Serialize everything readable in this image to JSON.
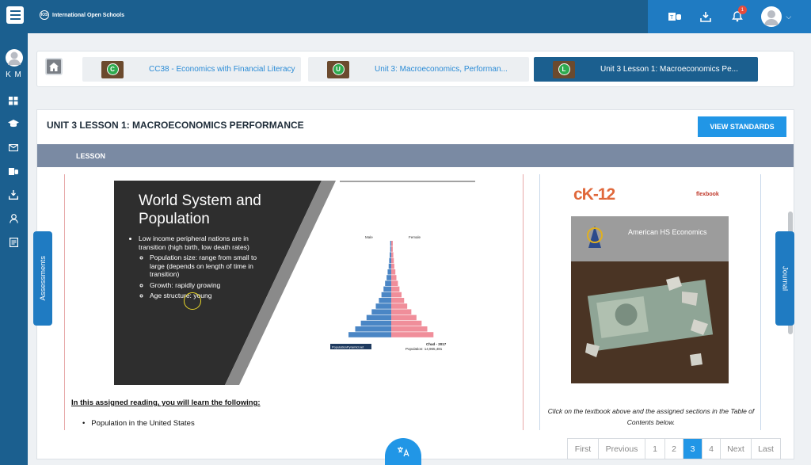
{
  "header": {
    "logo_text": "International Open Schools",
    "logo_mark": "IOS",
    "notification_count": "1"
  },
  "sidebar": {
    "user_initials": "K M"
  },
  "breadcrumbs": [
    {
      "letter": "C",
      "label": "CC38 - Economics with Financial Literacy"
    },
    {
      "letter": "U",
      "label": "Unit 3: Macroeconomics, Performan..."
    },
    {
      "letter": "L",
      "label": "Unit 3 Lesson 1: Macroeconomics Pe..."
    }
  ],
  "lesson": {
    "title": "UNIT 3 LESSON 1: MACROECONOMICS PERFORMANCE",
    "standards_label": "VIEW STANDARDS",
    "tab_label": "LESSON"
  },
  "slide": {
    "title_line1": "World System and",
    "title_line2": "Population",
    "bullet1": "Low income peripheral nations are in transition (high birth, low death rates)",
    "sub1": "Population size: range from small to large (depends on length of time in transition)",
    "sub2": "Growth: rapidly growing",
    "sub3": "Age structure: young",
    "pyramid_male": "Male",
    "pyramid_female": "Female",
    "pyramid_source": "PopulationPyramid.net",
    "pyramid_country": "Chad - 2017",
    "pyramid_population": "Population: 14,965,481"
  },
  "reading": {
    "heading": "In this assigned reading, you will learn the following:",
    "item1": "Population in the United States"
  },
  "textbook": {
    "brand": "cK-12",
    "flexbook": "flexbook",
    "book_title": "American HS Economics",
    "note": "Click on the textbook above and the assigned sections in the Table of Contents below."
  },
  "side_tabs": {
    "assessments": "Assessments",
    "journal": "Journal"
  },
  "pagination": {
    "first": "First",
    "previous": "Previous",
    "p1": "1",
    "p2": "2",
    "p3": "3",
    "p4": "4",
    "next": "Next",
    "last": "Last"
  },
  "colors": {
    "navy": "#1b5f8f",
    "accent": "#2196e6",
    "lesson_bar": "#7a8aa3"
  },
  "pyramid_data": {
    "male_pct": [
      0.2,
      0.2,
      0.3,
      0.4,
      0.5,
      0.7,
      0.9,
      1.2,
      1.5,
      1.9,
      2.4,
      3.0,
      3.8,
      4.8,
      5.9,
      7.0,
      8.3
    ],
    "female_pct": [
      0.3,
      0.3,
      0.4,
      0.5,
      0.6,
      0.8,
      1.0,
      1.3,
      1.6,
      2.0,
      2.5,
      3.1,
      3.9,
      4.9,
      5.9,
      7.0,
      8.2
    ]
  }
}
